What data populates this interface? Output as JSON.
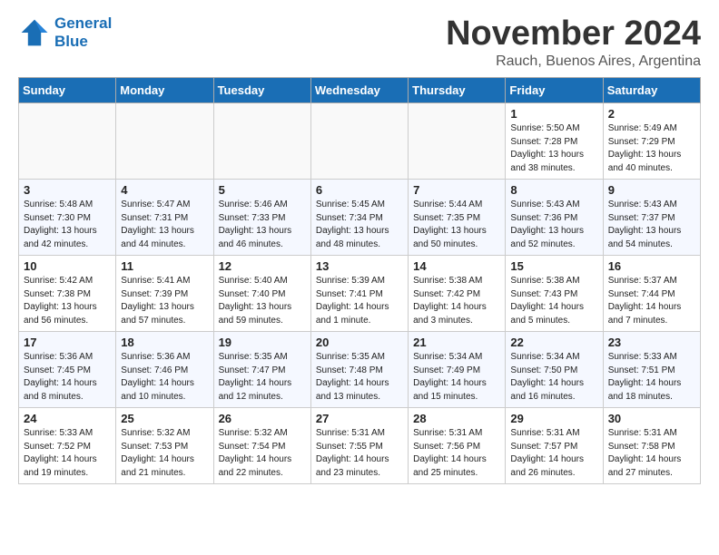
{
  "header": {
    "logo_line1": "General",
    "logo_line2": "Blue",
    "month_title": "November 2024",
    "location": "Rauch, Buenos Aires, Argentina"
  },
  "days_of_week": [
    "Sunday",
    "Monday",
    "Tuesday",
    "Wednesday",
    "Thursday",
    "Friday",
    "Saturday"
  ],
  "weeks": [
    [
      {
        "day": "",
        "info": ""
      },
      {
        "day": "",
        "info": ""
      },
      {
        "day": "",
        "info": ""
      },
      {
        "day": "",
        "info": ""
      },
      {
        "day": "",
        "info": ""
      },
      {
        "day": "1",
        "info": "Sunrise: 5:50 AM\nSunset: 7:28 PM\nDaylight: 13 hours\nand 38 minutes."
      },
      {
        "day": "2",
        "info": "Sunrise: 5:49 AM\nSunset: 7:29 PM\nDaylight: 13 hours\nand 40 minutes."
      }
    ],
    [
      {
        "day": "3",
        "info": "Sunrise: 5:48 AM\nSunset: 7:30 PM\nDaylight: 13 hours\nand 42 minutes."
      },
      {
        "day": "4",
        "info": "Sunrise: 5:47 AM\nSunset: 7:31 PM\nDaylight: 13 hours\nand 44 minutes."
      },
      {
        "day": "5",
        "info": "Sunrise: 5:46 AM\nSunset: 7:33 PM\nDaylight: 13 hours\nand 46 minutes."
      },
      {
        "day": "6",
        "info": "Sunrise: 5:45 AM\nSunset: 7:34 PM\nDaylight: 13 hours\nand 48 minutes."
      },
      {
        "day": "7",
        "info": "Sunrise: 5:44 AM\nSunset: 7:35 PM\nDaylight: 13 hours\nand 50 minutes."
      },
      {
        "day": "8",
        "info": "Sunrise: 5:43 AM\nSunset: 7:36 PM\nDaylight: 13 hours\nand 52 minutes."
      },
      {
        "day": "9",
        "info": "Sunrise: 5:43 AM\nSunset: 7:37 PM\nDaylight: 13 hours\nand 54 minutes."
      }
    ],
    [
      {
        "day": "10",
        "info": "Sunrise: 5:42 AM\nSunset: 7:38 PM\nDaylight: 13 hours\nand 56 minutes."
      },
      {
        "day": "11",
        "info": "Sunrise: 5:41 AM\nSunset: 7:39 PM\nDaylight: 13 hours\nand 57 minutes."
      },
      {
        "day": "12",
        "info": "Sunrise: 5:40 AM\nSunset: 7:40 PM\nDaylight: 13 hours\nand 59 minutes."
      },
      {
        "day": "13",
        "info": "Sunrise: 5:39 AM\nSunset: 7:41 PM\nDaylight: 14 hours\nand 1 minute."
      },
      {
        "day": "14",
        "info": "Sunrise: 5:38 AM\nSunset: 7:42 PM\nDaylight: 14 hours\nand 3 minutes."
      },
      {
        "day": "15",
        "info": "Sunrise: 5:38 AM\nSunset: 7:43 PM\nDaylight: 14 hours\nand 5 minutes."
      },
      {
        "day": "16",
        "info": "Sunrise: 5:37 AM\nSunset: 7:44 PM\nDaylight: 14 hours\nand 7 minutes."
      }
    ],
    [
      {
        "day": "17",
        "info": "Sunrise: 5:36 AM\nSunset: 7:45 PM\nDaylight: 14 hours\nand 8 minutes."
      },
      {
        "day": "18",
        "info": "Sunrise: 5:36 AM\nSunset: 7:46 PM\nDaylight: 14 hours\nand 10 minutes."
      },
      {
        "day": "19",
        "info": "Sunrise: 5:35 AM\nSunset: 7:47 PM\nDaylight: 14 hours\nand 12 minutes."
      },
      {
        "day": "20",
        "info": "Sunrise: 5:35 AM\nSunset: 7:48 PM\nDaylight: 14 hours\nand 13 minutes."
      },
      {
        "day": "21",
        "info": "Sunrise: 5:34 AM\nSunset: 7:49 PM\nDaylight: 14 hours\nand 15 minutes."
      },
      {
        "day": "22",
        "info": "Sunrise: 5:34 AM\nSunset: 7:50 PM\nDaylight: 14 hours\nand 16 minutes."
      },
      {
        "day": "23",
        "info": "Sunrise: 5:33 AM\nSunset: 7:51 PM\nDaylight: 14 hours\nand 18 minutes."
      }
    ],
    [
      {
        "day": "24",
        "info": "Sunrise: 5:33 AM\nSunset: 7:52 PM\nDaylight: 14 hours\nand 19 minutes."
      },
      {
        "day": "25",
        "info": "Sunrise: 5:32 AM\nSunset: 7:53 PM\nDaylight: 14 hours\nand 21 minutes."
      },
      {
        "day": "26",
        "info": "Sunrise: 5:32 AM\nSunset: 7:54 PM\nDaylight: 14 hours\nand 22 minutes."
      },
      {
        "day": "27",
        "info": "Sunrise: 5:31 AM\nSunset: 7:55 PM\nDaylight: 14 hours\nand 23 minutes."
      },
      {
        "day": "28",
        "info": "Sunrise: 5:31 AM\nSunset: 7:56 PM\nDaylight: 14 hours\nand 25 minutes."
      },
      {
        "day": "29",
        "info": "Sunrise: 5:31 AM\nSunset: 7:57 PM\nDaylight: 14 hours\nand 26 minutes."
      },
      {
        "day": "30",
        "info": "Sunrise: 5:31 AM\nSunset: 7:58 PM\nDaylight: 14 hours\nand 27 minutes."
      }
    ]
  ]
}
